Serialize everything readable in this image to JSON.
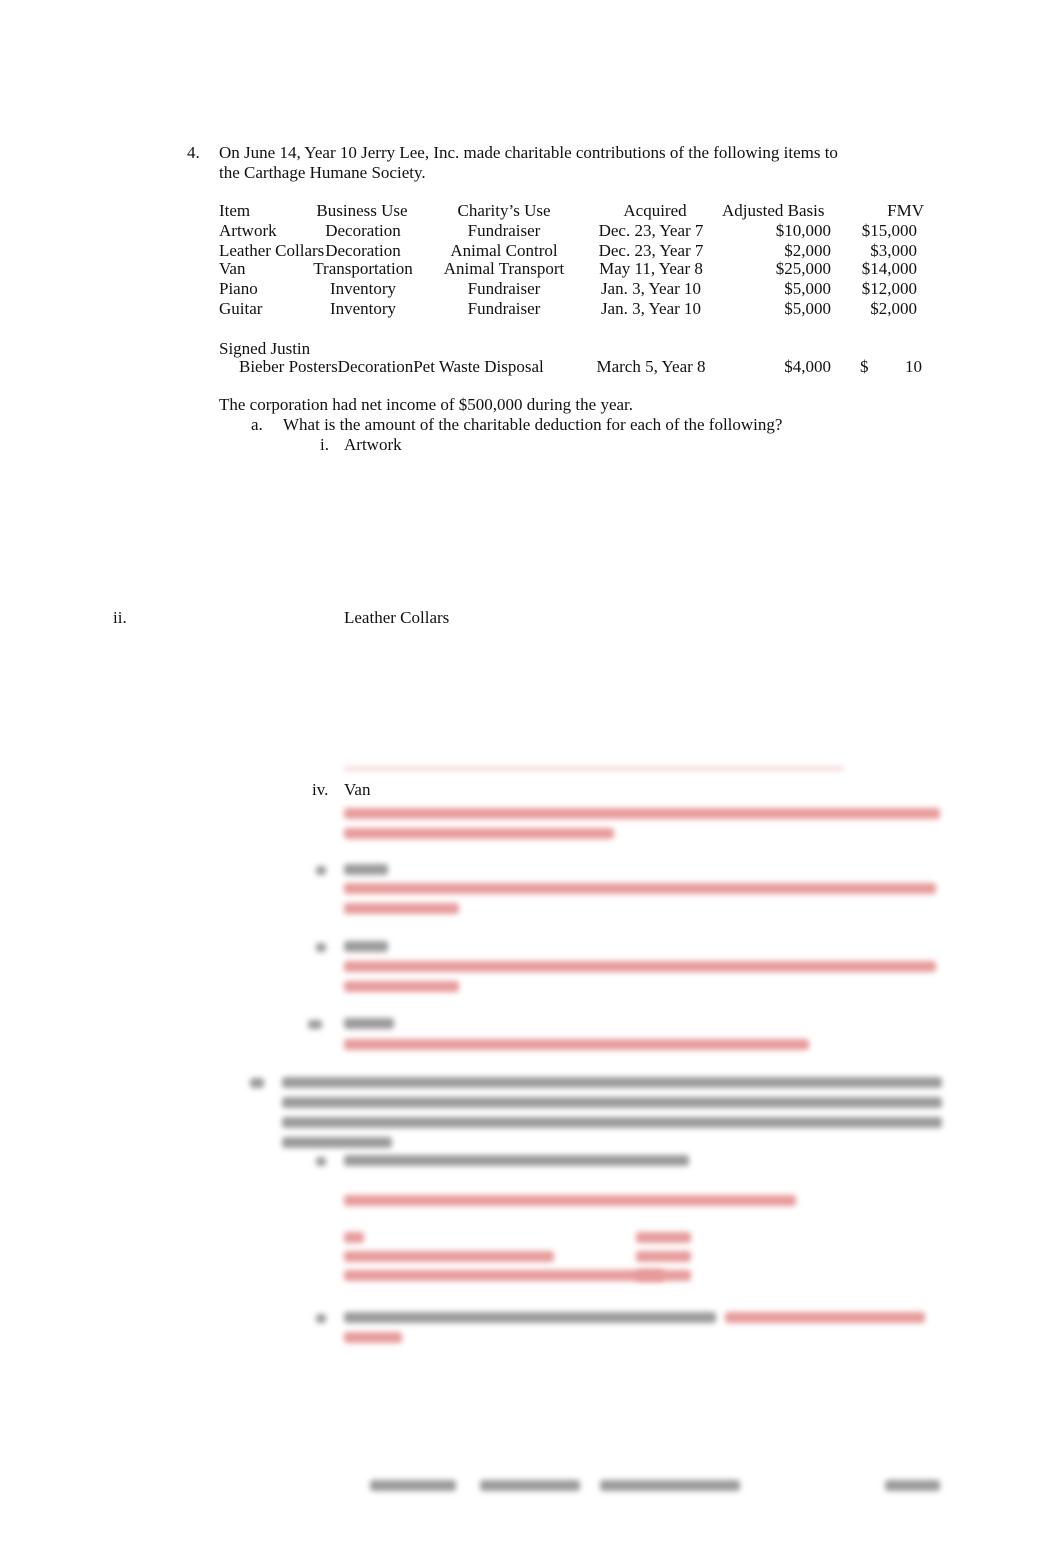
{
  "question": {
    "number": "4.",
    "intro_line1": "On June 14, Year 10 Jerry Lee, Inc. made charitable contributions of the following items to",
    "intro_line2": "the Carthage Humane Society.",
    "table": {
      "headers": [
        "Item",
        "Business Use",
        "Charity’s Use",
        "Acquired",
        "Adjusted Basis",
        "FMV"
      ],
      "rows": [
        [
          "Artwork",
          "Decoration",
          "Fundraiser",
          "Dec. 23, Year 7",
          "$10,000",
          "$15,000"
        ],
        [
          "Leather Collars",
          "Decoration",
          "Animal Control",
          "Dec. 23, Year 7",
          "$2,000",
          "$3,000"
        ],
        [
          "Van",
          "Transportation",
          "Animal Transport",
          "May 11, Year 8",
          "$25,000",
          "$14,000"
        ],
        [
          "Piano",
          "Inventory",
          "Fundraiser",
          "Jan. 3, Year 10",
          "$5,000",
          "$12,000"
        ],
        [
          "Guitar",
          "Inventory",
          "Fundraiser",
          "Jan. 3, Year 10",
          "$5,000",
          "$2,000"
        ]
      ],
      "last_item": {
        "line1": "Signed Justin",
        "line2": "Bieber PostersDecorationPet Waste Disposal",
        "acquired": "March 5, Year 8",
        "basis": "$4,000",
        "fmv_symbol": "$",
        "fmv_value": "10"
      }
    },
    "net_income": "The corporation had net income of $500,000 during the year.",
    "part_a": {
      "label": "a.",
      "text": "What is the amount of the charitable deduction for each of the following?",
      "items": [
        {
          "num": "i.",
          "label": "Artwork"
        },
        {
          "num": "ii.",
          "label": "Leather Collars"
        },
        {
          "num": "iv.",
          "label": "Van"
        }
      ]
    }
  }
}
